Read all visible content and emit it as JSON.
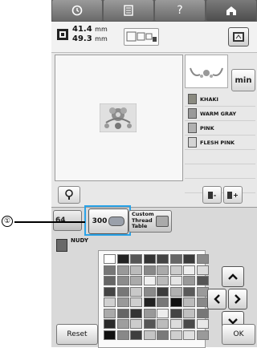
{
  "header": {
    "icons": [
      "clock-icon",
      "document-icon",
      "help-icon",
      "home-icon"
    ],
    "help_label": "?"
  },
  "size": {
    "width": "41.4",
    "height": "49.3",
    "unit": "mm"
  },
  "buttons": {
    "min": "min",
    "reset": "Reset",
    "ok": "OK",
    "select_prev": "-",
    "select_next": "+"
  },
  "threads": [
    {
      "name": "KHAKI",
      "color": "#8a8a80"
    },
    {
      "name": "WARM GRAY",
      "color": "#9a9a9a"
    },
    {
      "name": "PINK",
      "color": "#b0b0b0"
    },
    {
      "name": "FLESH PINK",
      "color": "#d4d4d4"
    }
  ],
  "tabs": {
    "tab_64": "64",
    "tab_300": "300",
    "custom": [
      "Custom",
      "Thread",
      "Table"
    ]
  },
  "current_thread": {
    "name": "NUDY",
    "color": "#6a6a6a"
  },
  "callout": {
    "number": "①"
  },
  "palette": [
    [
      "#ffffff",
      "#222222",
      "#555555",
      "#333333",
      "#444444",
      "#666666",
      "#3a3a3a",
      "#8a8a8a"
    ],
    [
      "#777777",
      "#999999",
      "#bbbbbb",
      "#888888",
      "#aaaaaa",
      "#cccccc",
      "#eeeeee",
      "#dddddd"
    ],
    [
      "#666666",
      "#8c8c8c",
      "#aaaaaa",
      "#f0f0f0",
      "#bababa",
      "#e5e5e5",
      "#999999",
      "#555555"
    ],
    [
      "#444444",
      "#777777",
      "#c8c8c8",
      "#8a8a8a",
      "#3c3c3c",
      "#b0b0b0",
      "#5a5a5a",
      "#9a9a9a"
    ],
    [
      "#d0d0d0",
      "#999999",
      "#cfcfcf",
      "#222222",
      "#777777",
      "#111111",
      "#bbbbbb",
      "#888888"
    ],
    [
      "#aaaaaa",
      "#666666",
      "#333333",
      "#999999",
      "#ededed",
      "#444444",
      "#c0c0c0",
      "#777777"
    ],
    [
      "#2a2a2a",
      "#9e9e9e",
      "#cccccc",
      "#555555",
      "#bbbbbb",
      "#dddddd",
      "#4a4a4a",
      "#e8e8e8"
    ],
    [
      "#111111",
      "#888888",
      "#3e3e3e",
      "#c4c4c4",
      "#7a7a7a",
      "#cfcfcf",
      "#e0e0e0",
      "#9a9a9a"
    ]
  ]
}
